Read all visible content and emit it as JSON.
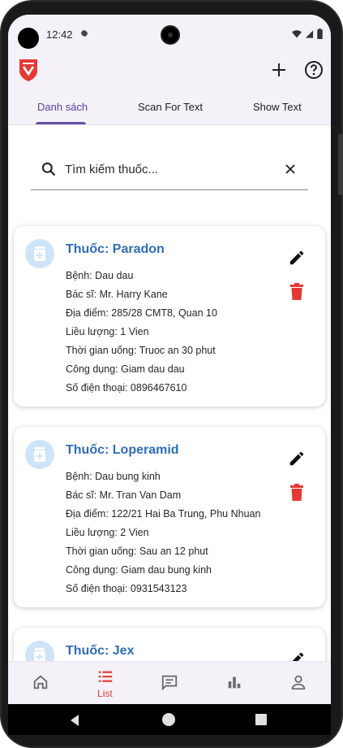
{
  "status_bar": {
    "time": "12:42"
  },
  "tabs": [
    {
      "label": "Danh sách",
      "active": true
    },
    {
      "label": "Scan For Text",
      "active": false
    },
    {
      "label": "Show Text",
      "active": false
    }
  ],
  "search": {
    "placeholder": "Tìm kiếm thuốc..."
  },
  "medicines": [
    {
      "title": "Thuốc: Paradon",
      "lines": [
        "Bệnh: Dau dau",
        "Bác sĩ: Mr. Harry Kane",
        "Địa điểm: 285/28 CMT8, Quan 10",
        "Liều lượng: 1 Vien",
        "Thời gian uống: Truoc an 30 phut",
        "Công dụng: Giam dau dau",
        "Số điện thoại: 0896467610"
      ]
    },
    {
      "title": "Thuốc: Loperamid",
      "lines": [
        "Bệnh: Dau bung kinh",
        "Bác sĩ: Mr. Tran Van Dam",
        "Địa điểm: 122/21 Hai Ba Trung, Phu Nhuan",
        "Liều lượng: 2 Vien",
        "Thời gian uống: Sau an 12 phut",
        "Công dụng: Giam dau bung kinh",
        "Số điện thoại: 0931543123"
      ]
    },
    {
      "title": "Thuốc: Jex",
      "lines": []
    }
  ],
  "bottom_nav": {
    "items": [
      {
        "icon": "home-icon",
        "label": ""
      },
      {
        "icon": "list-icon",
        "label": "List",
        "active": true
      },
      {
        "icon": "chat-icon",
        "label": ""
      },
      {
        "icon": "bar-chart-icon",
        "label": ""
      },
      {
        "icon": "person-icon",
        "label": ""
      }
    ]
  },
  "colors": {
    "accent": "#6750a4",
    "title_blue": "#2f6db8",
    "delete_red": "#e53935",
    "brand_red": "#e53935"
  }
}
